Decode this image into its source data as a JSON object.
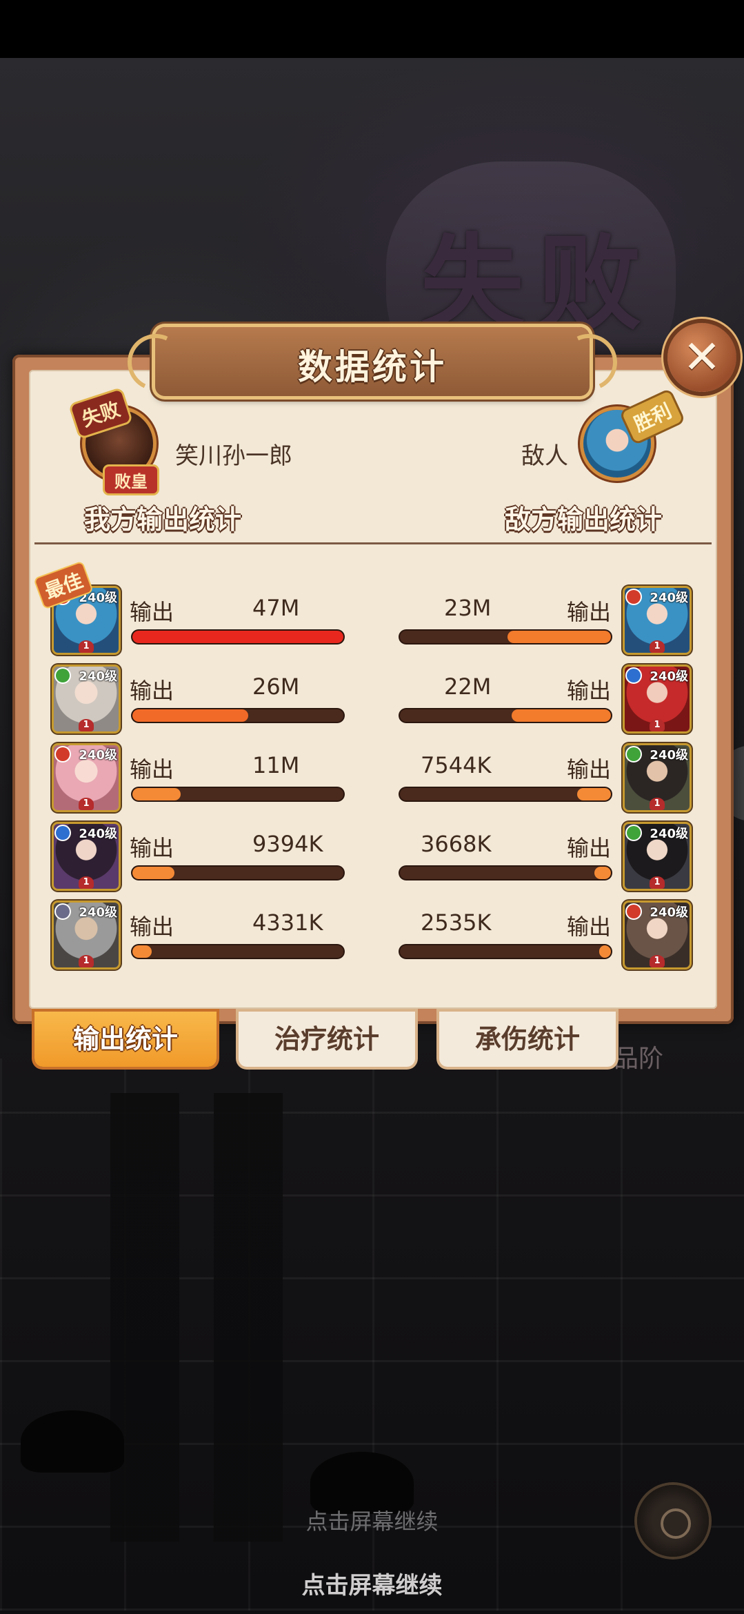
{
  "background": {
    "result_text": "失败",
    "side_label": "品阶",
    "continue_hint_faded": "点击屏幕继续"
  },
  "dialog": {
    "title": "数据统计",
    "close_icon": "close-x-icon"
  },
  "teams": {
    "ours": {
      "name": "笑川孙一郎",
      "caption": "我方输出统计",
      "result_badge": "失败",
      "rank_badge": "败皇"
    },
    "enemy": {
      "name": "敌人",
      "caption": "敌方输出统计",
      "result_badge": "胜利"
    }
  },
  "best_tag": "最佳",
  "stat_label": "输出",
  "rows": [
    {
      "left": {
        "level": "240级",
        "element": "#d23b2a",
        "value": "47M",
        "ratio": 1.0,
        "color": "#e8281e"
      },
      "right": {
        "level": "240级",
        "element": "#d23b2a",
        "value": "23M",
        "ratio": 0.49,
        "color": "#f27b2c"
      }
    },
    {
      "left": {
        "level": "240级",
        "element": "#3fa33a",
        "value": "26M",
        "ratio": 0.55,
        "color": "#f26a28"
      },
      "right": {
        "level": "240级",
        "element": "#2d6fd0",
        "value": "22M",
        "ratio": 0.47,
        "color": "#f27b2c"
      }
    },
    {
      "left": {
        "level": "240级",
        "element": "#d23b2a",
        "value": "11M",
        "ratio": 0.23,
        "color": "#f58a36"
      },
      "right": {
        "level": "240级",
        "element": "#3fa33a",
        "value": "7544K",
        "ratio": 0.16,
        "color": "#f58a36"
      }
    },
    {
      "left": {
        "level": "240级",
        "element": "#2d6fd0",
        "value": "9394K",
        "ratio": 0.2,
        "color": "#f58a36"
      },
      "right": {
        "level": "240级",
        "element": "#3fa33a",
        "value": "3668K",
        "ratio": 0.08,
        "color": "#f58a36"
      }
    },
    {
      "left": {
        "level": "240级",
        "element": "#6a6a8a",
        "value": "4331K",
        "ratio": 0.09,
        "color": "#f58a36"
      },
      "right": {
        "level": "240级",
        "element": "#d23b2a",
        "value": "2535K",
        "ratio": 0.055,
        "color": "#f58a36"
      }
    }
  ],
  "tabs": [
    {
      "label": "输出统计",
      "active": true
    },
    {
      "label": "治疗统计",
      "active": false
    },
    {
      "label": "承伤统计",
      "active": false
    }
  ],
  "continue_hint": "点击屏幕继续"
}
